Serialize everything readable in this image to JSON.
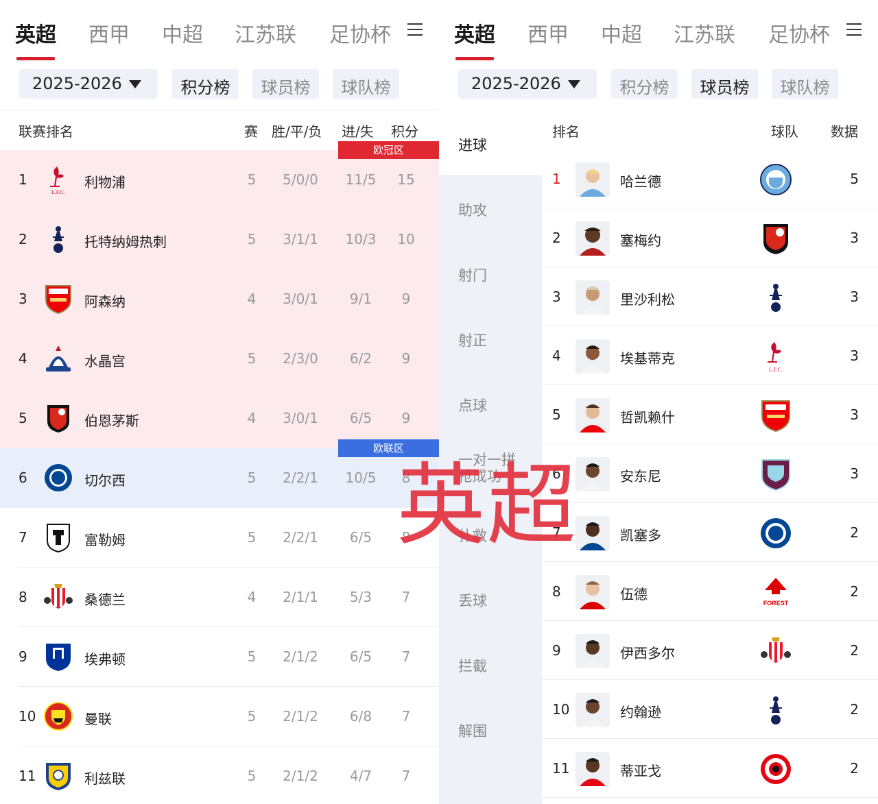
{
  "league_tabs": [
    "英超",
    "西甲",
    "中超",
    "江苏联",
    "足协杯"
  ],
  "season": "2025-2026",
  "board_tabs": [
    "积分榜",
    "球员榜",
    "球队榜"
  ],
  "standings": {
    "headers": {
      "rank": "联赛排名",
      "played": "赛",
      "wdl": "胜/平/负",
      "goals": "进/失",
      "points": "积分"
    },
    "zones": {
      "ucl": "欧冠区",
      "uel": "欧联区"
    },
    "rows": [
      {
        "rank": "1",
        "team": "利物浦",
        "crest": "liverpool-crest",
        "played": "5",
        "wdl": "5/0/0",
        "goals": "11/5",
        "points": "15"
      },
      {
        "rank": "2",
        "team": "托特纳姆热刺",
        "crest": "tottenham-crest",
        "played": "5",
        "wdl": "3/1/1",
        "goals": "10/3",
        "points": "10"
      },
      {
        "rank": "3",
        "team": "阿森纳",
        "crest": "arsenal-crest",
        "played": "4",
        "wdl": "3/0/1",
        "goals": "9/1",
        "points": "9"
      },
      {
        "rank": "4",
        "team": "水晶宫",
        "crest": "crystal-palace-crest",
        "played": "5",
        "wdl": "2/3/0",
        "goals": "6/2",
        "points": "9"
      },
      {
        "rank": "5",
        "team": "伯恩茅斯",
        "crest": "bournemouth-crest",
        "played": "4",
        "wdl": "3/0/1",
        "goals": "6/5",
        "points": "9"
      },
      {
        "rank": "6",
        "team": "切尔西",
        "crest": "chelsea-crest",
        "played": "5",
        "wdl": "2/2/1",
        "goals": "10/5",
        "points": "8"
      },
      {
        "rank": "7",
        "team": "富勒姆",
        "crest": "fulham-crest",
        "played": "5",
        "wdl": "2/2/1",
        "goals": "6/5",
        "points": "8"
      },
      {
        "rank": "8",
        "team": "桑德兰",
        "crest": "sunderland-crest",
        "played": "4",
        "wdl": "2/1/1",
        "goals": "5/3",
        "points": "7"
      },
      {
        "rank": "9",
        "team": "埃弗顿",
        "crest": "everton-crest",
        "played": "5",
        "wdl": "2/1/2",
        "goals": "6/5",
        "points": "7"
      },
      {
        "rank": "10",
        "team": "曼联",
        "crest": "man-united-crest",
        "played": "5",
        "wdl": "2/1/2",
        "goals": "6/8",
        "points": "7"
      },
      {
        "rank": "11",
        "team": "利兹联",
        "crest": "leeds-crest",
        "played": "5",
        "wdl": "2/1/2",
        "goals": "4/7",
        "points": "7"
      }
    ]
  },
  "player_stats": {
    "categories": [
      "进球",
      "助攻",
      "射门",
      "射正",
      "点球",
      "一对一拼抢成功",
      "扑救",
      "丢球",
      "拦截",
      "解围"
    ],
    "headers": {
      "rank": "排名",
      "team": "球队",
      "value": "数据"
    },
    "rows": [
      {
        "rank": "1",
        "player": "哈兰德",
        "crest": "man-city-crest",
        "value": "5"
      },
      {
        "rank": "2",
        "player": "塞梅约",
        "crest": "bournemouth-crest",
        "value": "3"
      },
      {
        "rank": "3",
        "player": "里沙利松",
        "crest": "tottenham-crest",
        "value": "3"
      },
      {
        "rank": "4",
        "player": "埃基蒂克",
        "crest": "liverpool-crest",
        "value": "3"
      },
      {
        "rank": "5",
        "player": "哲凯赖什",
        "crest": "arsenal-crest",
        "value": "3"
      },
      {
        "rank": "6",
        "player": "安东尼",
        "crest": "burnley-crest",
        "value": "3"
      },
      {
        "rank": "7",
        "player": "凯塞多",
        "crest": "chelsea-crest",
        "value": "2"
      },
      {
        "rank": "8",
        "player": "伍德",
        "crest": "nottingham-forest-crest",
        "value": "2"
      },
      {
        "rank": "9",
        "player": "伊西多尔",
        "crest": "sunderland-crest",
        "value": "2"
      },
      {
        "rank": "10",
        "player": "约翰逊",
        "crest": "tottenham-crest",
        "value": "2"
      },
      {
        "rank": "11",
        "player": "蒂亚戈",
        "crest": "brentford-crest",
        "value": "2"
      }
    ]
  },
  "watermark": "英超",
  "colors": {
    "accent": "#d81e2a",
    "ucl_zone": "#e02832",
    "uel_zone": "#3b6fe0",
    "ucl_row": "#fdeaed",
    "uel_row": "#e8effb",
    "chip_bg": "#eef1f7"
  }
}
